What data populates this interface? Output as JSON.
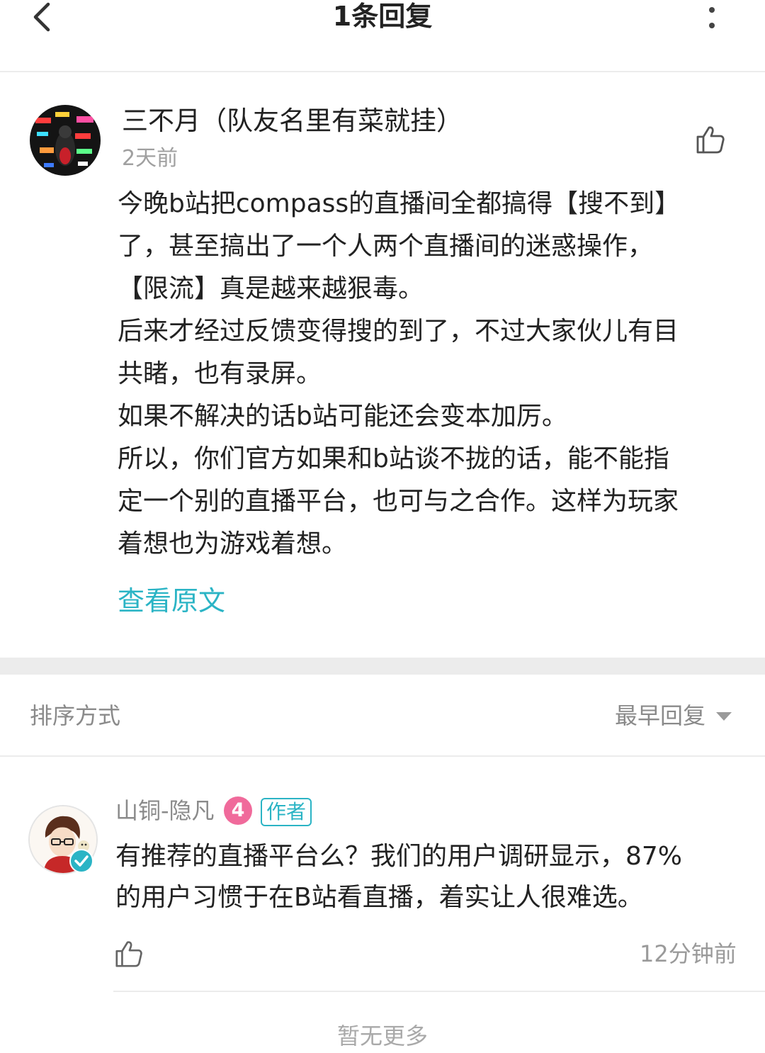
{
  "header": {
    "title": "1条回复"
  },
  "post": {
    "username": "三不月（队友名里有菜就挂）",
    "time": "2天前",
    "content_lines": [
      "今晚b站把compass的直播间全都搞得【搜不到】",
      "了，甚至搞出了一个人两个直播间的迷惑操作，",
      "【限流】真是越来越狠毒。",
      "后来才经过反馈变得搜的到了，不过大家伙儿有目",
      "共睹，也有录屏。",
      "如果不解决的话b站可能还会变本加厉。",
      "所以，你们官方如果和b站谈不拢的话，能不能指",
      "定一个别的直播平台，也可与之合作。这样为玩家",
      "着想也为游戏着想。"
    ],
    "view_original": "查看原文"
  },
  "sort": {
    "label": "排序方式",
    "value": "最早回复"
  },
  "reply": {
    "username": "山铜-隐凡",
    "level": "4",
    "author_tag": "作者",
    "content_lines": [
      "有推荐的直播平台么？我们的用户调研显示，87%",
      "的用户习惯于在B站看直播，着实让人很难选。"
    ],
    "time": "12分钟前"
  },
  "footer": {
    "no_more": "暂无更多"
  },
  "colors": {
    "accent": "#2bb4c5",
    "level_badge": "#f06a9b",
    "divider": "#ececec",
    "muted_text": "#8a8a8a"
  },
  "icons": [
    "back-arrow-icon",
    "more-vertical-icon",
    "thumbs-up-icon",
    "caret-down-icon",
    "verified-check-icon"
  ]
}
